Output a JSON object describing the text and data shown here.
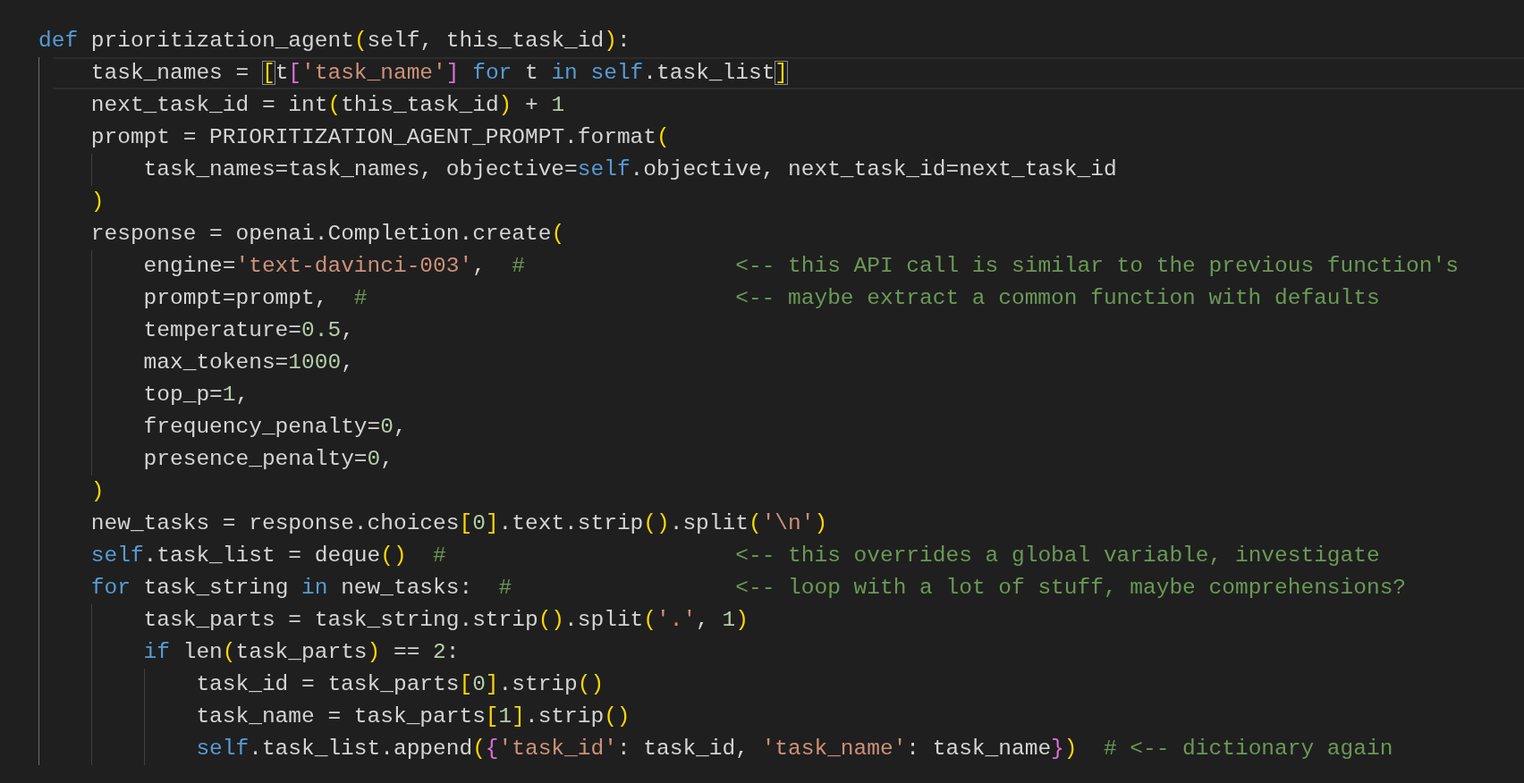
{
  "editor": {
    "lines": [
      {
        "current": false,
        "tokens": [
          {
            "kind": "keyword",
            "text": "def"
          },
          {
            "kind": "plain",
            "text": " prioritization_agent"
          },
          {
            "kind": "bracket1",
            "text": "("
          },
          {
            "kind": "plain",
            "text": "self, this_task_id"
          },
          {
            "kind": "bracket1",
            "text": ")"
          },
          {
            "kind": "plain",
            "text": ":"
          }
        ],
        "children": [
          {
            "current": true,
            "tokens": [
              {
                "kind": "plain",
                "text": "task_names = "
              },
              {
                "kind": "bracket-match",
                "text": "["
              },
              {
                "kind": "plain",
                "text": "t"
              },
              {
                "kind": "bracket2",
                "text": "["
              },
              {
                "kind": "string",
                "text": "'task_name'"
              },
              {
                "kind": "bracket2",
                "text": "]"
              },
              {
                "kind": "keyword",
                "text": " for"
              },
              {
                "kind": "plain",
                "text": " t "
              },
              {
                "kind": "keyword",
                "text": "in"
              },
              {
                "kind": "keyword",
                "text": " self"
              },
              {
                "kind": "plain",
                "text": ".task_list"
              },
              {
                "kind": "bracket-match",
                "text": "]"
              }
            ]
          },
          {
            "current": false,
            "tokens": [
              {
                "kind": "plain",
                "text": "next_task_id = int"
              },
              {
                "kind": "bracket1",
                "text": "("
              },
              {
                "kind": "plain",
                "text": "this_task_id"
              },
              {
                "kind": "bracket1",
                "text": ")"
              },
              {
                "kind": "plain",
                "text": " + "
              },
              {
                "kind": "number",
                "text": "1"
              }
            ]
          },
          {
            "current": false,
            "tokens": [
              {
                "kind": "plain",
                "text": "prompt = PRIORITIZATION_AGENT_PROMPT.format"
              },
              {
                "kind": "bracket1",
                "text": "("
              }
            ],
            "children": [
              {
                "current": false,
                "tokens": [
                  {
                    "kind": "plain",
                    "text": "task_names=task_names, objective="
                  },
                  {
                    "kind": "keyword",
                    "text": "self"
                  },
                  {
                    "kind": "plain",
                    "text": ".objective, next_task_id=next_task_id"
                  }
                ]
              }
            ]
          },
          {
            "current": false,
            "tokens": [
              {
                "kind": "bracket1",
                "text": ")"
              }
            ]
          },
          {
            "current": false,
            "tokens": [
              {
                "kind": "plain",
                "text": "response = openai.Completion.create"
              },
              {
                "kind": "bracket1",
                "text": "("
              }
            ],
            "children": [
              {
                "current": false,
                "tokens": [
                  {
                    "kind": "plain",
                    "text": "engine="
                  },
                  {
                    "kind": "string",
                    "text": "'text-davinci-003'"
                  },
                  {
                    "kind": "plain",
                    "text": ",  "
                  },
                  {
                    "kind": "comment",
                    "text": "#                <-- this API call is similar to the previous function's"
                  }
                ]
              },
              {
                "current": false,
                "tokens": [
                  {
                    "kind": "plain",
                    "text": "prompt=prompt,  "
                  },
                  {
                    "kind": "comment",
                    "text": "#                            <-- maybe extract a common function with defaults"
                  }
                ]
              },
              {
                "current": false,
                "tokens": [
                  {
                    "kind": "plain",
                    "text": "temperature="
                  },
                  {
                    "kind": "number",
                    "text": "0.5"
                  },
                  {
                    "kind": "plain",
                    "text": ","
                  }
                ]
              },
              {
                "current": false,
                "tokens": [
                  {
                    "kind": "plain",
                    "text": "max_tokens="
                  },
                  {
                    "kind": "number",
                    "text": "1000"
                  },
                  {
                    "kind": "plain",
                    "text": ","
                  }
                ]
              },
              {
                "current": false,
                "tokens": [
                  {
                    "kind": "plain",
                    "text": "top_p="
                  },
                  {
                    "kind": "number",
                    "text": "1"
                  },
                  {
                    "kind": "plain",
                    "text": ","
                  }
                ]
              },
              {
                "current": false,
                "tokens": [
                  {
                    "kind": "plain",
                    "text": "frequency_penalty="
                  },
                  {
                    "kind": "number",
                    "text": "0"
                  },
                  {
                    "kind": "plain",
                    "text": ","
                  }
                ]
              },
              {
                "current": false,
                "tokens": [
                  {
                    "kind": "plain",
                    "text": "presence_penalty="
                  },
                  {
                    "kind": "number",
                    "text": "0"
                  },
                  {
                    "kind": "plain",
                    "text": ","
                  }
                ]
              }
            ]
          },
          {
            "current": false,
            "tokens": [
              {
                "kind": "bracket1",
                "text": ")"
              }
            ]
          },
          {
            "current": false,
            "tokens": [
              {
                "kind": "plain",
                "text": "new_tasks = response.choices"
              },
              {
                "kind": "bracket1",
                "text": "["
              },
              {
                "kind": "number",
                "text": "0"
              },
              {
                "kind": "bracket1",
                "text": "]"
              },
              {
                "kind": "plain",
                "text": ".text.strip"
              },
              {
                "kind": "bracket1",
                "text": "()"
              },
              {
                "kind": "plain",
                "text": ".split"
              },
              {
                "kind": "bracket1",
                "text": "("
              },
              {
                "kind": "string",
                "text": "'\\n'"
              },
              {
                "kind": "bracket1",
                "text": ")"
              }
            ]
          },
          {
            "current": false,
            "tokens": [
              {
                "kind": "keyword",
                "text": "self"
              },
              {
                "kind": "plain",
                "text": ".task_list = deque"
              },
              {
                "kind": "bracket1",
                "text": "()"
              },
              {
                "kind": "comment",
                "text": "  #                      <-- this overrides a global variable, investigate"
              }
            ]
          },
          {
            "current": false,
            "tokens": [
              {
                "kind": "keyword",
                "text": "for"
              },
              {
                "kind": "plain",
                "text": " task_string "
              },
              {
                "kind": "keyword",
                "text": "in"
              },
              {
                "kind": "plain",
                "text": " new_tasks:  "
              },
              {
                "kind": "comment",
                "text": "#                 <-- loop with a lot of stuff, maybe comprehensions?"
              }
            ],
            "children": [
              {
                "current": false,
                "tokens": [
                  {
                    "kind": "plain",
                    "text": "task_parts = task_string.strip"
                  },
                  {
                    "kind": "bracket1",
                    "text": "()"
                  },
                  {
                    "kind": "plain",
                    "text": ".split"
                  },
                  {
                    "kind": "bracket1",
                    "text": "("
                  },
                  {
                    "kind": "string",
                    "text": "'.'"
                  },
                  {
                    "kind": "plain",
                    "text": ", "
                  },
                  {
                    "kind": "number",
                    "text": "1"
                  },
                  {
                    "kind": "bracket1",
                    "text": ")"
                  }
                ]
              },
              {
                "current": false,
                "tokens": [
                  {
                    "kind": "keyword",
                    "text": "if"
                  },
                  {
                    "kind": "plain",
                    "text": " len"
                  },
                  {
                    "kind": "bracket1",
                    "text": "("
                  },
                  {
                    "kind": "plain",
                    "text": "task_parts"
                  },
                  {
                    "kind": "bracket1",
                    "text": ")"
                  },
                  {
                    "kind": "plain",
                    "text": " == "
                  },
                  {
                    "kind": "number",
                    "text": "2"
                  },
                  {
                    "kind": "plain",
                    "text": ":"
                  }
                ],
                "children": [
                  {
                    "current": false,
                    "tokens": [
                      {
                        "kind": "plain",
                        "text": "task_id = task_parts"
                      },
                      {
                        "kind": "bracket1",
                        "text": "["
                      },
                      {
                        "kind": "number",
                        "text": "0"
                      },
                      {
                        "kind": "bracket1",
                        "text": "]"
                      },
                      {
                        "kind": "plain",
                        "text": ".strip"
                      },
                      {
                        "kind": "bracket1",
                        "text": "()"
                      }
                    ]
                  },
                  {
                    "current": false,
                    "tokens": [
                      {
                        "kind": "plain",
                        "text": "task_name = task_parts"
                      },
                      {
                        "kind": "bracket1",
                        "text": "["
                      },
                      {
                        "kind": "number",
                        "text": "1"
                      },
                      {
                        "kind": "bracket1",
                        "text": "]"
                      },
                      {
                        "kind": "plain",
                        "text": ".strip"
                      },
                      {
                        "kind": "bracket1",
                        "text": "()"
                      }
                    ]
                  },
                  {
                    "current": false,
                    "tokens": [
                      {
                        "kind": "keyword",
                        "text": "self"
                      },
                      {
                        "kind": "plain",
                        "text": ".task_list.append"
                      },
                      {
                        "kind": "bracket1",
                        "text": "("
                      },
                      {
                        "kind": "bracket2",
                        "text": "{"
                      },
                      {
                        "kind": "string",
                        "text": "'task_id'"
                      },
                      {
                        "kind": "plain",
                        "text": ": task_id, "
                      },
                      {
                        "kind": "string",
                        "text": "'task_name'"
                      },
                      {
                        "kind": "plain",
                        "text": ": task_name"
                      },
                      {
                        "kind": "bracket2",
                        "text": "}"
                      },
                      {
                        "kind": "bracket1",
                        "text": ")"
                      },
                      {
                        "kind": "comment",
                        "text": "  # <-- dictionary again"
                      }
                    ]
                  }
                ]
              }
            ]
          }
        ]
      }
    ]
  }
}
